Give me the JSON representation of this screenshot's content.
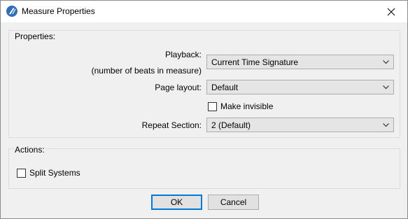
{
  "window": {
    "title": "Measure Properties",
    "app_icon": "app-logo-icon",
    "close_icon": "close-icon"
  },
  "properties": {
    "group_label": "Properties:",
    "playback_label": "Playback:",
    "playback_sublabel": "(number of beats in measure)",
    "playback_value": "Current Time Signature",
    "page_layout_label": "Page layout:",
    "page_layout_value": "Default",
    "make_invisible_label": "Make invisible",
    "make_invisible_checked": false,
    "repeat_section_label": "Repeat Section:",
    "repeat_section_value": "2 (Default)"
  },
  "actions": {
    "group_label": "Actions:",
    "split_systems_label": "Split Systems",
    "split_systems_checked": false
  },
  "buttons": {
    "ok_label": "OK",
    "cancel_label": "Cancel"
  },
  "colors": {
    "accent": "#0078d7",
    "dialog_bg": "#f0f0f0",
    "combo_bg": "#e5e5e5"
  }
}
